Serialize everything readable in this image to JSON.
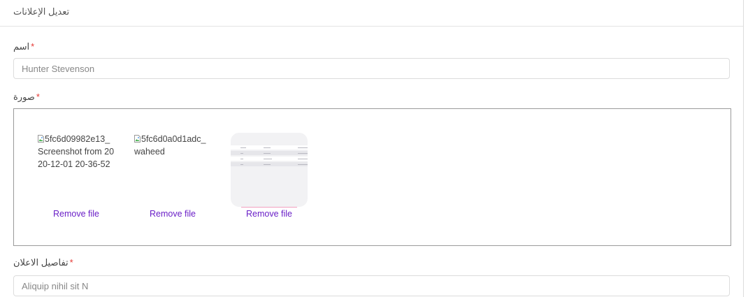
{
  "header": {
    "title": "تعديل الإعلانات"
  },
  "form": {
    "name": {
      "label": "اسم",
      "value": "Hunter Stevenson"
    },
    "image": {
      "label": "صورة",
      "files": [
        {
          "alt": "5fc6d09982e13_Screenshot from 2020-12-01 20-36-52",
          "remove_label": "Remove file"
        },
        {
          "alt": "5fc6d0a0d1adc_waheed",
          "remove_label": "Remove file"
        },
        {
          "preview": true,
          "remove_label": "Remove file"
        }
      ]
    },
    "details": {
      "label": "تفاصيل الاعلان",
      "value": "Aliquip nihil sit N"
    },
    "required_mark": "*"
  },
  "colors": {
    "link": "#6a1fc7",
    "required": "#e53935",
    "border": "#dcdcdc"
  }
}
